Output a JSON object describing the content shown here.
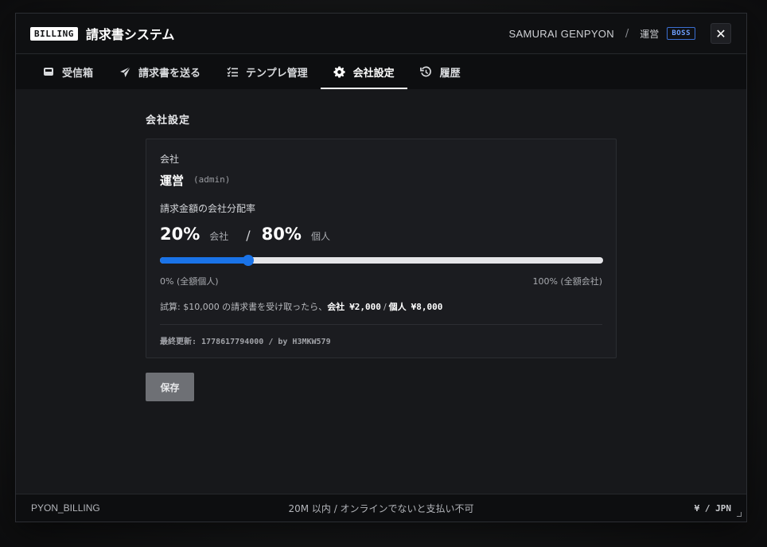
{
  "header": {
    "badge": "BILLING",
    "title": "請求書システム",
    "user": "SAMURAI GENPYON",
    "separator": "/",
    "role": "運営",
    "role_badge": "BOSS",
    "close": "✕"
  },
  "tabs": [
    {
      "label": "受信箱",
      "icon": "inbox-icon"
    },
    {
      "label": "請求書を送る",
      "icon": "send-icon"
    },
    {
      "label": "テンプレ管理",
      "icon": "list-check-icon"
    },
    {
      "label": "会社設定",
      "icon": "gear-icon",
      "active": true
    },
    {
      "label": "履歴",
      "icon": "history-icon"
    }
  ],
  "settings": {
    "section_title": "会社設定",
    "company_label": "会社",
    "company_name": "運営",
    "company_role": "(admin)",
    "ratio_label": "請求金額の会社分配率",
    "company_pct": "20%",
    "company_pct_label": "会社",
    "ratio_sep": "/",
    "personal_pct": "80%",
    "personal_pct_label": "個人",
    "slider_value": 0.2,
    "range_min": "0% (全額個人)",
    "range_max": "100% (全額会社)",
    "trial_prefix": "試算: $10,000 の請求書を受け取ったら、",
    "trial_company_label": "会社",
    "trial_company_amount": "¥2,000",
    "trial_slash": "/",
    "trial_personal_label": "個人",
    "trial_personal_amount": "¥8,000",
    "updated": "最終更新: 1778617794000 / by H3MKW579",
    "save": "保存"
  },
  "footer": {
    "left": "PYON_BILLING",
    "center": "20M 以内 / オンラインでないと支払い不可",
    "right": "¥ / JPN"
  },
  "colors": {
    "accent": "#1a73e8",
    "boss_badge": "#6ea0ff"
  }
}
